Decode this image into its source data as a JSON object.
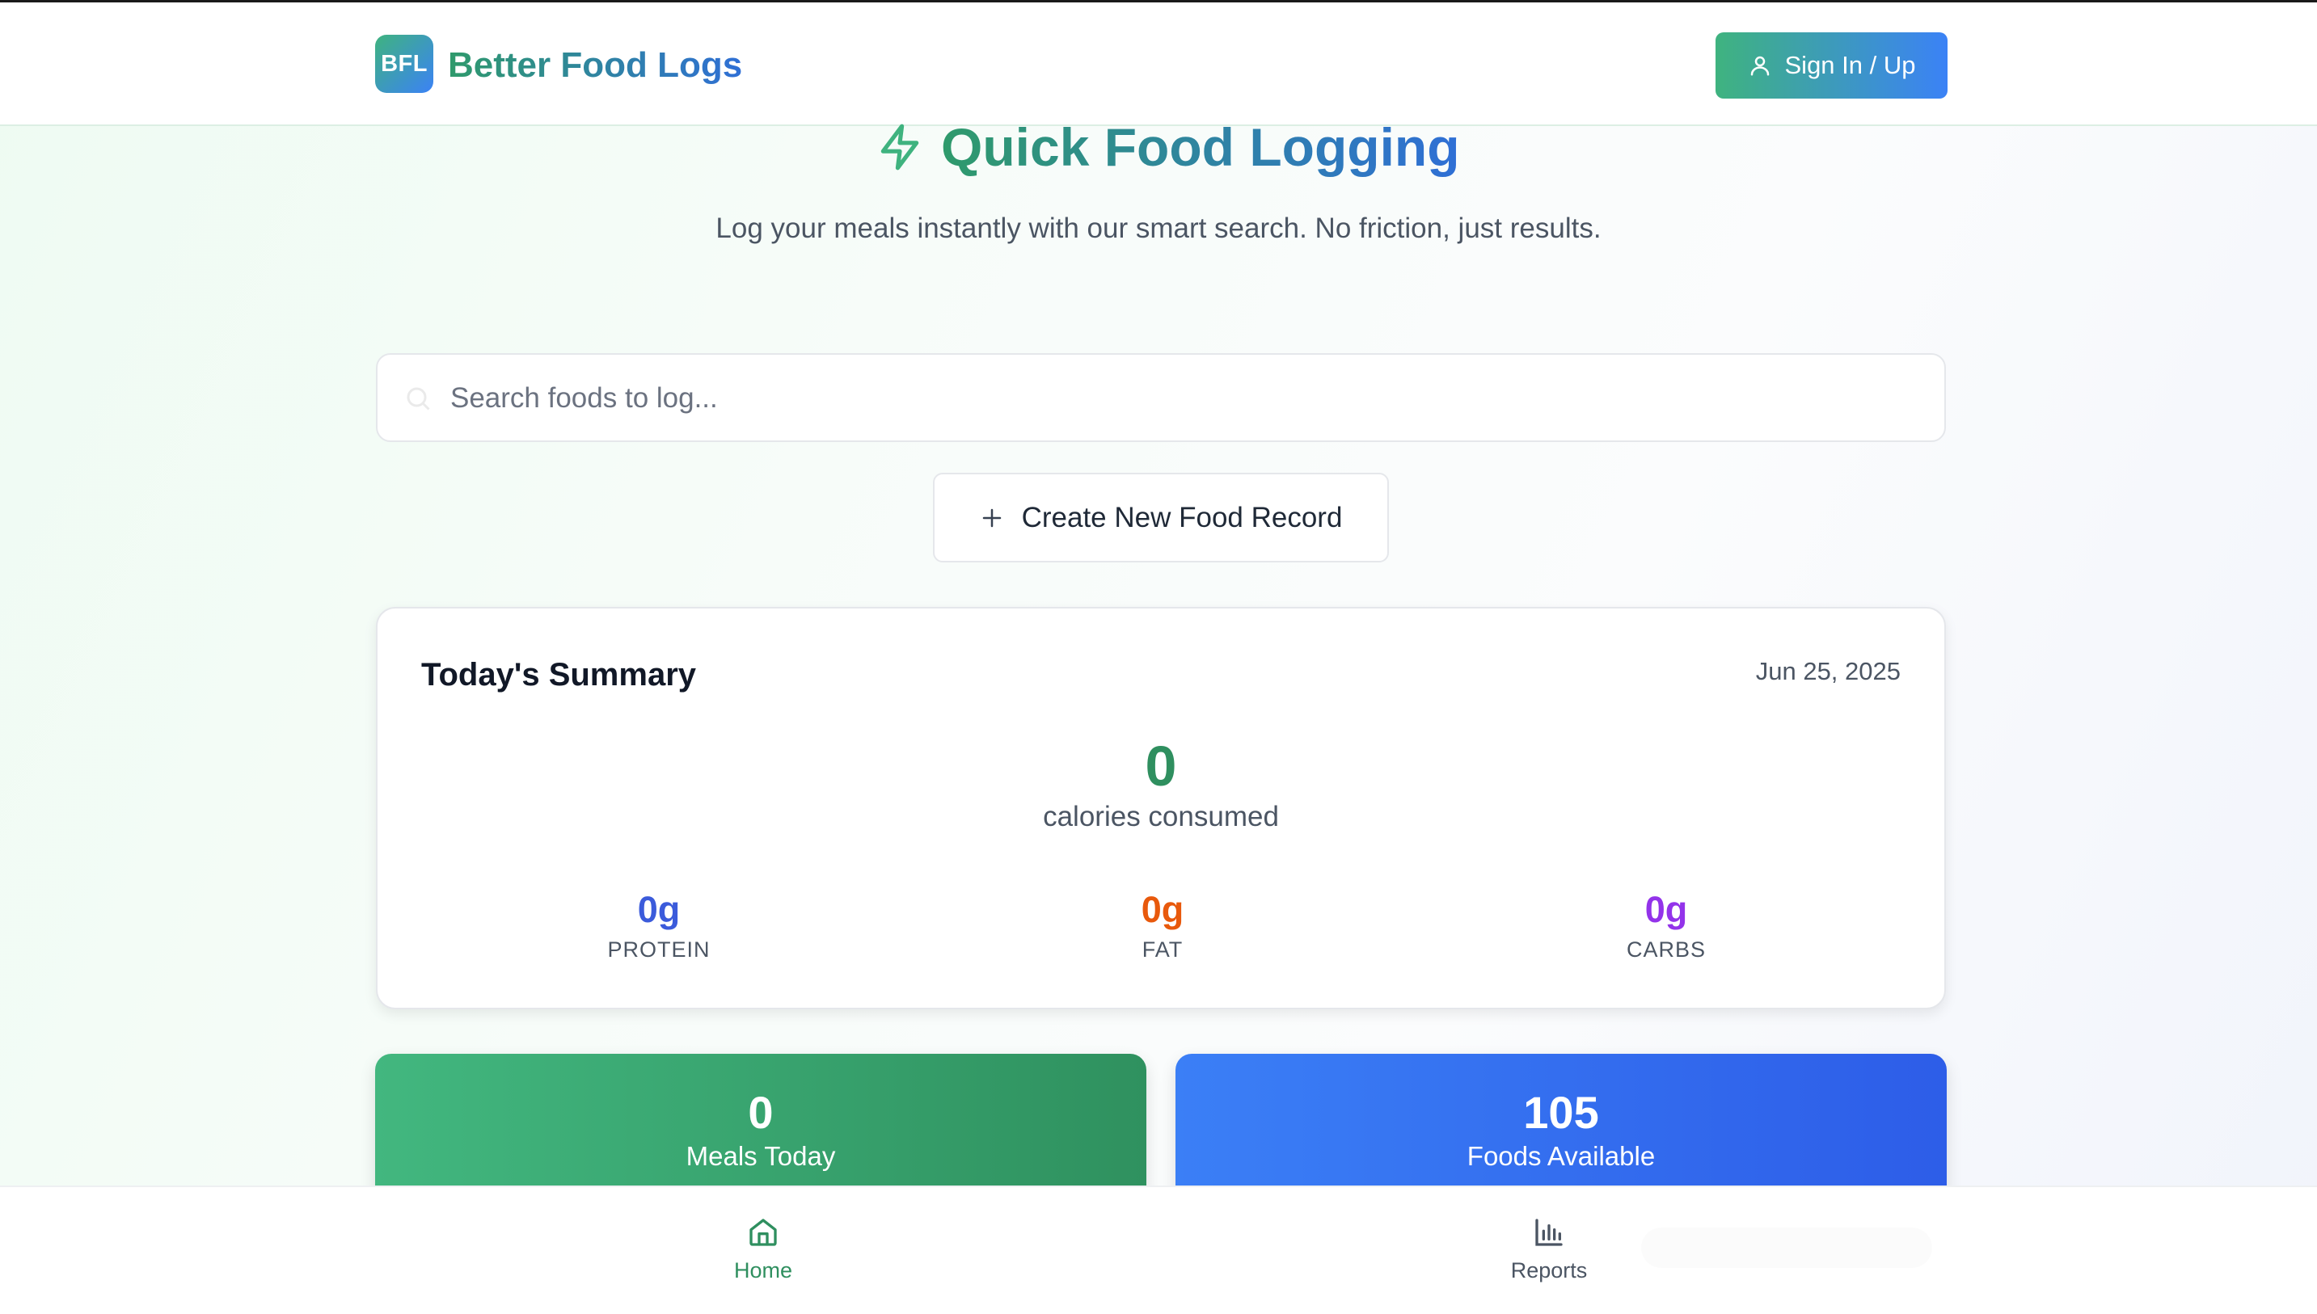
{
  "header": {
    "logo_text": "BFL",
    "brand_name": "Better Food Logs",
    "signin_label": "Sign In / Up"
  },
  "hero": {
    "title": "Quick Food Logging",
    "subtitle": "Log your meals instantly with our smart search. No friction, just results."
  },
  "search": {
    "placeholder": "Search foods to log...",
    "value": ""
  },
  "create_button_label": "Create New Food Record",
  "summary": {
    "title": "Today's Summary",
    "date": "Jun 25, 2025",
    "calories_value": "0",
    "calories_label": "calories consumed",
    "macros": [
      {
        "value": "0g",
        "label": "PROTEIN",
        "color": "#3b5bdb"
      },
      {
        "value": "0g",
        "label": "FAT",
        "color": "#e8590c"
      },
      {
        "value": "0g",
        "label": "CARBS",
        "color": "#9333ea"
      }
    ]
  },
  "stats": [
    {
      "value": "0",
      "label": "Meals Today"
    },
    {
      "value": "105",
      "label": "Foods Available"
    }
  ],
  "nav": {
    "home_label": "Home",
    "reports_label": "Reports"
  },
  "colors": {
    "accent_green": "#2f8f5f",
    "accent_blue": "#2f6fd6"
  }
}
